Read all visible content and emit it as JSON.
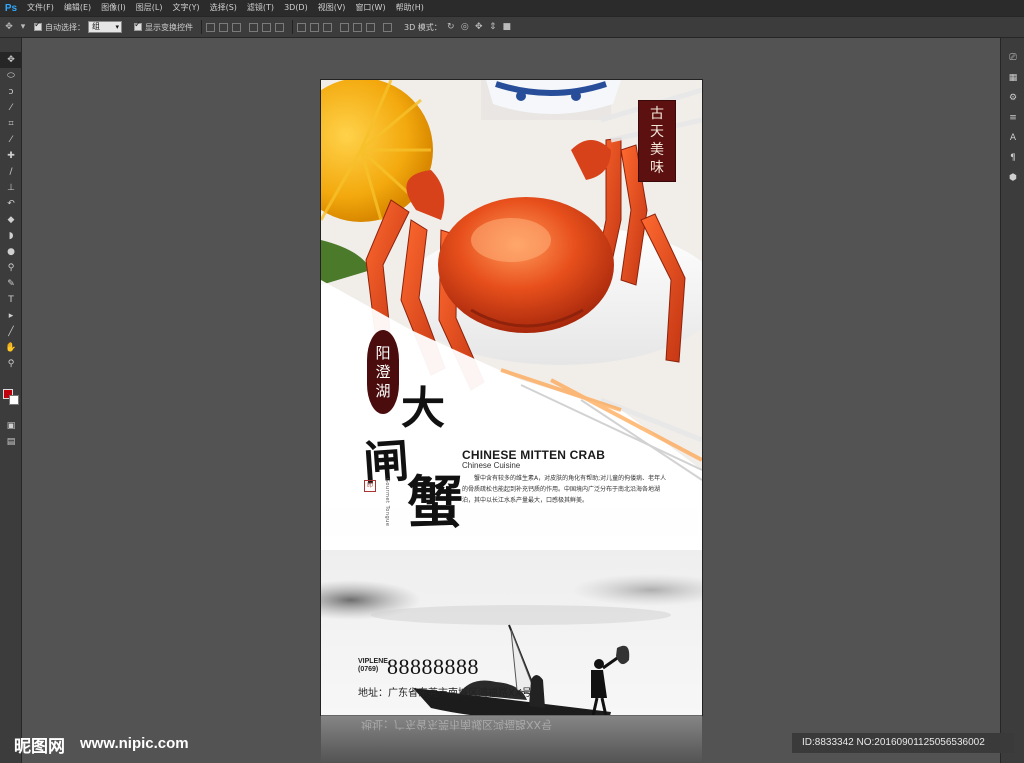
{
  "app": {
    "logo": "Ps"
  },
  "menu": [
    "文件(F)",
    "编辑(E)",
    "图像(I)",
    "图层(L)",
    "文字(Y)",
    "选择(S)",
    "滤镜(T)",
    "3D(D)",
    "视图(V)",
    "窗口(W)",
    "帮助(H)"
  ],
  "options": {
    "auto_select_label": "自动选择：",
    "auto_select_value": "组",
    "show_transform_label": "显示变换控件",
    "mode_3d_label": "3D 模式："
  },
  "poster": {
    "stamp": [
      "古",
      "天",
      "美",
      "味"
    ],
    "badge": [
      "阳",
      "澄",
      "湖"
    ],
    "big_title": [
      "大",
      "闸",
      "蟹"
    ],
    "vertical_small": "Gourmet Tongue",
    "title_en": "CHINESE MITTEN CRAB",
    "subtitle_en": "Chinese  Cuisine",
    "description": "蟹中含有较多的维生素A，对皮肤的角化有帮助;对儿童的佝偻病、老年人的骨质疏松也能起到补充钙质的作用。中国境内广泛分布于南北沿海各地湖泊，其中以长江水系产量最大，口感极其鲜美。",
    "phone_label_top": "VIPLENE",
    "phone_label_bottom": "(0769)",
    "phone": "88888888",
    "address": "地址：广东省东莞市南城区鸿福路XX号"
  },
  "watermark": {
    "logo": "昵图网",
    "url": "www.nipic.com",
    "id": "ID:8833342 NO:20160901125056536002"
  },
  "colors": {
    "fg_swatch": "#c1000e",
    "bg_swatch": "#ffffff",
    "badge": "#4a0c0c",
    "stamp": "#5c1010"
  }
}
